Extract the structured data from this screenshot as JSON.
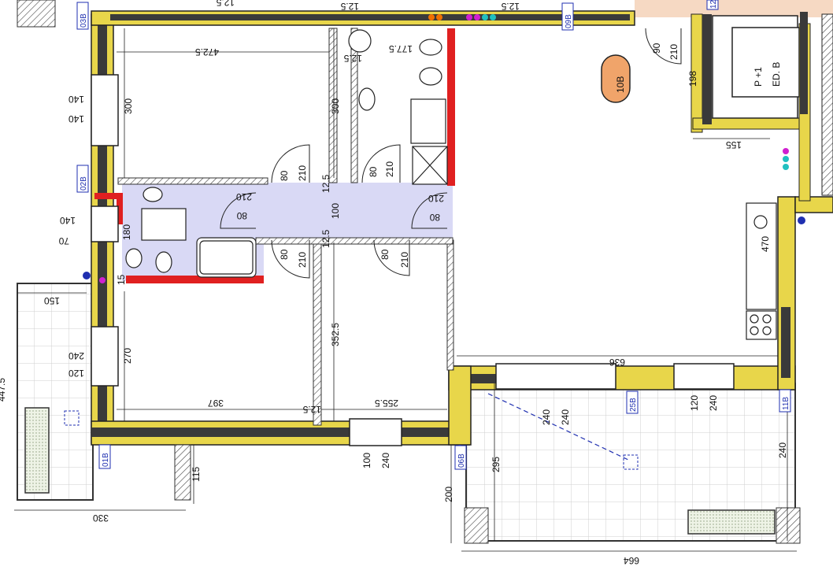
{
  "apartment": {
    "label": "10B"
  },
  "stairs_label": {
    "line1": "P +1",
    "line2": "ED. B"
  },
  "wall_tags": [
    "03B",
    "09B",
    "02B",
    "01B",
    "06B",
    "25B",
    "11B",
    "12"
  ],
  "dimensions": {
    "top_472": "472.5",
    "top_12a": "12.5",
    "top_12b": "12.5",
    "top_12c": "12.5",
    "top_177": "177.5",
    "top_12d": "12.5",
    "room_300a": "300",
    "room_300b": "300",
    "w1_140a": "140",
    "w1_140b": "140",
    "w2_140": "140",
    "w2_70": "70",
    "w2_180": "180",
    "w2_15": "15",
    "w3_240": "240",
    "w3_120": "120",
    "w3_270": "270",
    "bal_150": "150",
    "bal_447": "447.5",
    "d1_80": "80",
    "d1_210": "210",
    "d2_80": "80",
    "d2_210": "210",
    "d3_210": "210",
    "d3_80": "80",
    "d4_210": "210",
    "d4_80": "80",
    "d5_80": "80",
    "d5_210": "210",
    "d6_80": "80",
    "d6_210": "210",
    "d7_90": "90",
    "d7_210": "210",
    "corr_12a": "12.5",
    "corr_100": "100",
    "corr_12b": "12.5",
    "room_352": "352.5",
    "bot_397": "397",
    "bot_12": "12.5",
    "bot_255": "255.5",
    "win_100": "100",
    "win_240": "240",
    "left_115": "115",
    "left_330": "330",
    "r_198": "198",
    "r_155": "155",
    "r_470": "470",
    "r_636": "636",
    "t_240a": "240",
    "t_240b": "240",
    "t_120": "120",
    "t_240c": "240",
    "t_295": "295",
    "t_240d": "240",
    "t_200": "200",
    "t_664": "664"
  },
  "colors": {
    "wall_dark": "#3a3a3a",
    "insulation": "#e8d64a",
    "wet_area": "#d9d9f5",
    "red_wall": "#e02020",
    "label_fill": "#f0a46a",
    "tag_blue": "#1f2fb0",
    "terrace_grid": "#c9c9c9",
    "planter": "#dfe8cf"
  }
}
